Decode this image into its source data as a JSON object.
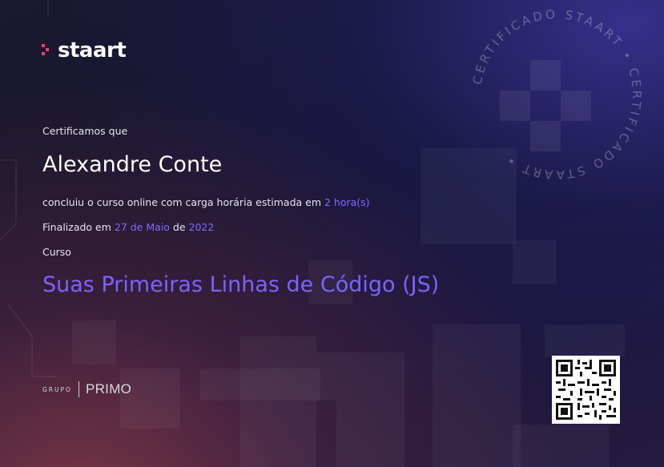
{
  "brand": {
    "logo_text": "staart",
    "logo_accent_color": "#ff3c6e"
  },
  "seal": {
    "ring_text": "CERTIFICADO STAART • CERTIFICADO STAART •"
  },
  "certificate": {
    "intro": "Certificamos que",
    "recipient": "Alexandre Conte",
    "completion_prefix": "concluiu o curso online com carga horária estimada em ",
    "duration": "2 hora(s)",
    "finished_prefix": "Finalizado em ",
    "finished_date": "27 de Maio",
    "finished_mid": " de ",
    "finished_year": "2022",
    "course_label": "Curso",
    "course_name": "Suas Primeiras Linhas de Código (JS)",
    "accent_color": "#7b63ff"
  },
  "footer": {
    "group_small": "GRUPO",
    "group_name": "PRIMO"
  },
  "qr": {
    "icon": "qr-code-icon"
  }
}
